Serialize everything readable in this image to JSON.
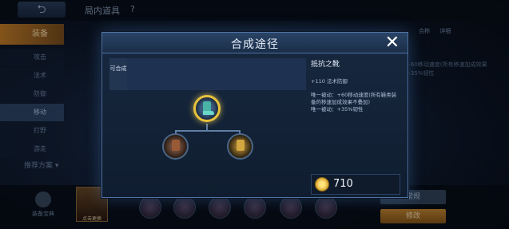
{
  "topbar": {
    "title": "局内道具",
    "help": "?",
    "back_glyph": "⮌"
  },
  "sidebar": {
    "items": [
      {
        "label": "装备"
      },
      {
        "label": "攻击"
      },
      {
        "label": "法术"
      },
      {
        "label": "防御"
      },
      {
        "label": "移动"
      },
      {
        "label": "打野"
      },
      {
        "label": "游走"
      }
    ],
    "recommend": "推荐方案 ▾"
  },
  "right_panel": {
    "icons": [
      "合称",
      "详细"
    ],
    "desc": "+60移动速度(所有移速加成效果 +35%韧性"
  },
  "bottom": {
    "shop_label": "装备宝典",
    "hero_label": "点击更换",
    "btn_normal": "常规",
    "btn_edit": "修改"
  },
  "modal": {
    "title": "合成途径",
    "close_glyph": "✕",
    "craft_label": "可合成",
    "item": {
      "name": "抵抗之靴",
      "stat": "+110 法术防御",
      "passive_1": "唯一被动：+60移动速度(所有鞋类装备的移速加成效果不叠加)",
      "passive_2": "唯一被动：+35%韧性"
    },
    "price": "710"
  },
  "colors": {
    "accent_gold": "#e7c23c",
    "modal_border": "#4f73a3",
    "equip_orange": "#c9812a"
  }
}
